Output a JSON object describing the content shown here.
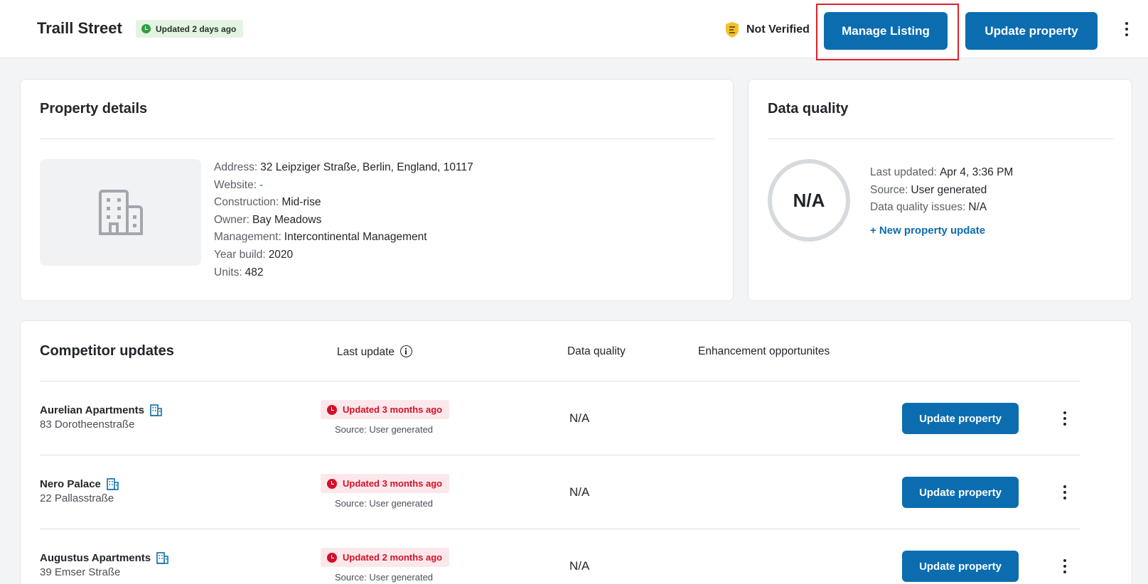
{
  "header": {
    "title": "Traill Street",
    "updated_badge": "Updated 2 days ago",
    "verification_status": "Not Verified",
    "manage_listing_label": "Manage Listing",
    "update_property_label": "Update property"
  },
  "property_details": {
    "title": "Property details",
    "fields": [
      {
        "label": "Address:",
        "value": "32 Leipziger Straße, Berlin, England, 10117"
      },
      {
        "label": "Website:",
        "value": "-"
      },
      {
        "label": "Construction:",
        "value": "Mid-rise"
      },
      {
        "label": "Owner:",
        "value": "Bay Meadows"
      },
      {
        "label": "Management:",
        "value": "Intercontinental Management"
      },
      {
        "label": "Year build:",
        "value": "2020"
      },
      {
        "label": "Units:",
        "value": "482"
      }
    ]
  },
  "data_quality": {
    "title": "Data quality",
    "score": "N/A",
    "fields": [
      {
        "label": "Last updated:",
        "value": "Apr 4, 3:36 PM"
      },
      {
        "label": "Source:",
        "value": "User generated"
      },
      {
        "label": "Data quality issues:",
        "value": "N/A"
      }
    ],
    "new_update_link": "+ New property update"
  },
  "competitors": {
    "title": "Competitor updates",
    "columns": {
      "last_update": "Last update",
      "data_quality": "Data quality",
      "enhancement": "Enhancement opportunites"
    },
    "rows": [
      {
        "name": "Aurelian Apartments",
        "address": "83 Dorotheenstraße",
        "updated": "Updated 3 months ago",
        "source": "Source: User generated",
        "data_quality": "N/A",
        "action": "Update property"
      },
      {
        "name": "Nero Palace",
        "address": "22 Pallasstraße",
        "updated": "Updated 3 months ago",
        "source": "Source: User generated",
        "data_quality": "N/A",
        "action": "Update property"
      },
      {
        "name": "Augustus Apartments",
        "address": "39 Emser Straße",
        "updated": "Updated 2 months ago",
        "source": "Source: User generated",
        "data_quality": "N/A",
        "action": "Update property"
      }
    ]
  },
  "colors": {
    "primary": "#0b6db0",
    "highlight": "#e0202a",
    "badge_green": "#e3f4e2",
    "badge_red": "#fce8ea",
    "warning_red": "#d3102a",
    "shield_yellow": "#f2c12e"
  },
  "icons": [
    "check-circle-icon",
    "shield-icon",
    "more-vertical-icon",
    "building-icon",
    "info-icon",
    "clock-icon"
  ]
}
